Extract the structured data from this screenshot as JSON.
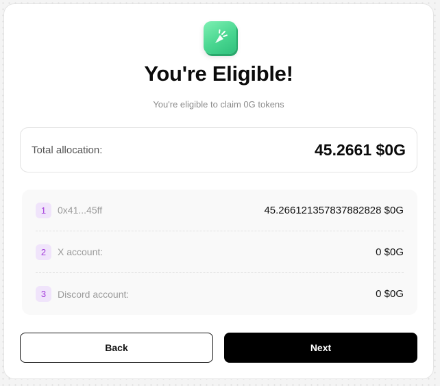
{
  "logo": {
    "icon": "gift-sparkle-icon",
    "color": "#49d690"
  },
  "title": "You're Eligible!",
  "subtitle": "You're eligible to claim 0G tokens",
  "total": {
    "label": "Total allocation:",
    "value": "45.2661 $0G"
  },
  "breakdown": [
    {
      "number": "1",
      "label": "0x41...45ff",
      "value": "45.266121357837882828 $0G"
    },
    {
      "number": "2",
      "label": "X account:",
      "value": "0 $0G"
    },
    {
      "number": "3",
      "label": "Discord account:",
      "value": "0 $0G"
    }
  ],
  "buttons": {
    "back": "Back",
    "next": "Next"
  },
  "colors": {
    "accent": "#a33bd9",
    "badge_bg": "#f0e4fb",
    "primary": "#000000"
  }
}
